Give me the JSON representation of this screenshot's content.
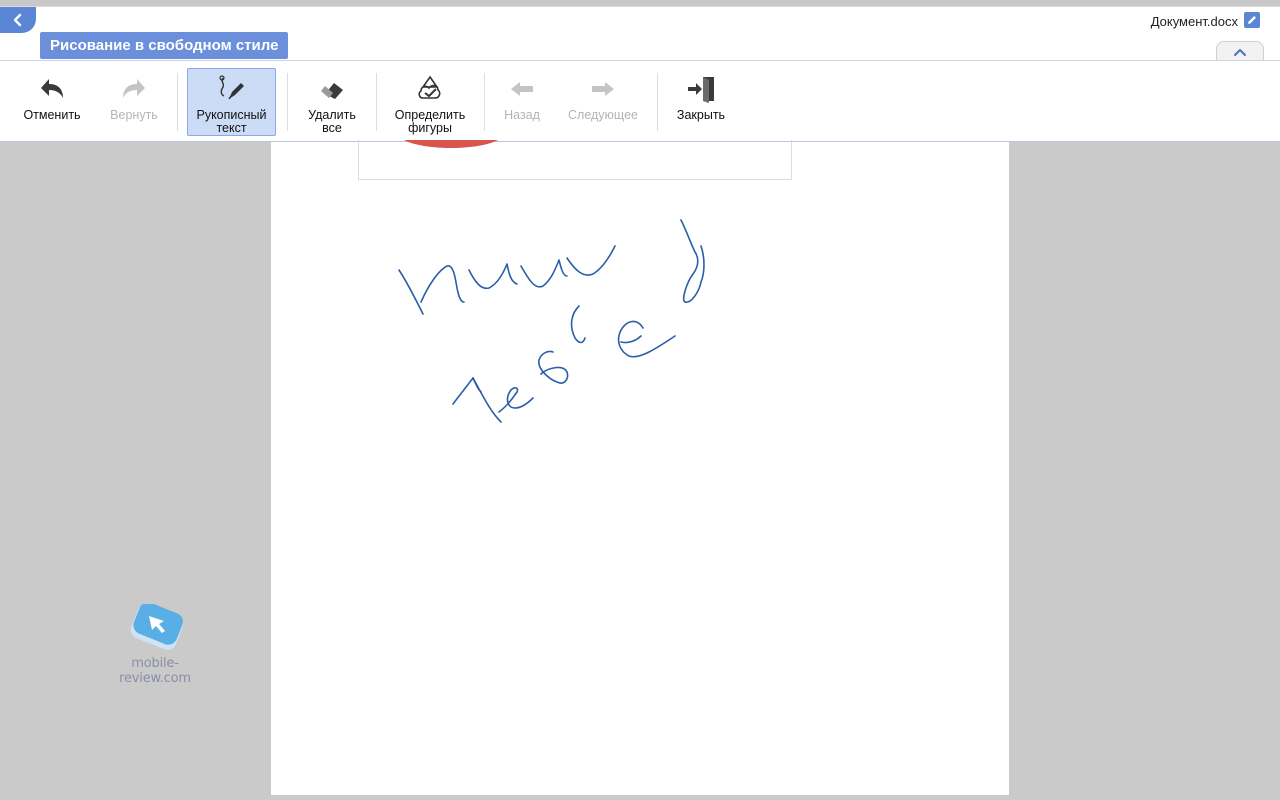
{
  "header": {
    "back_icon": "chevron-left-icon",
    "mode_title": "Рисование в свободном стиле",
    "document_name": "Документ.docx",
    "edit_icon": "pencil-icon",
    "collapse_icon": "chevron-up-icon"
  },
  "toolbar": {
    "undo": {
      "label": "Отменить",
      "icon": "undo-icon",
      "enabled": true
    },
    "redo": {
      "label": "Вернуть",
      "icon": "redo-icon",
      "enabled": false
    },
    "handwriting": {
      "label_line1": "Рукописный",
      "label_line2": "текст",
      "icon": "pen-icon",
      "active": true
    },
    "delete_all": {
      "label_line1": "Удалить",
      "label_line2": "все",
      "icon": "eraser-icon",
      "enabled": true
    },
    "detect_shapes": {
      "label_line1": "Определить",
      "label_line2": "фигуры",
      "icon": "shape-recognition-icon",
      "enabled": true
    },
    "back": {
      "label": "Назад",
      "icon": "arrow-left-icon",
      "enabled": false
    },
    "next": {
      "label": "Следующее",
      "icon": "arrow-right-icon",
      "enabled": false
    },
    "close": {
      "label": "Закрыть",
      "icon": "exit-door-icon",
      "enabled": true
    }
  },
  "document": {
    "handwriting_color": "#2a5fa8",
    "image_accent_color": "#d9534f"
  },
  "watermark": {
    "text": "mobile-review.com"
  },
  "colors": {
    "accent": "#6b8fdb",
    "active_tool_bg": "#cddcf6",
    "canvas_bg": "#cacaca"
  }
}
